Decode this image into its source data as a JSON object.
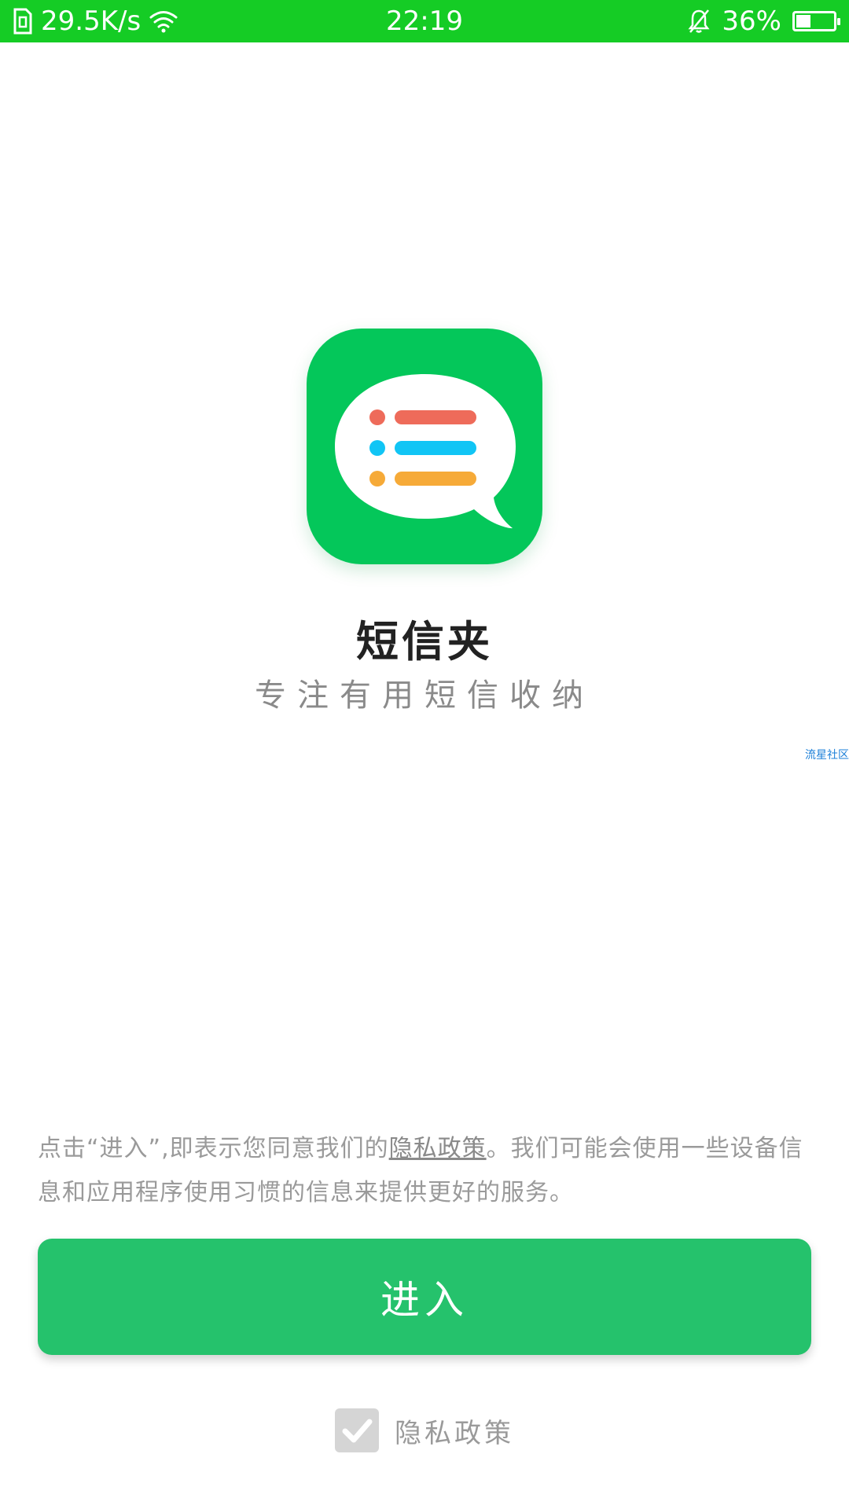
{
  "status_bar": {
    "network_speed": "29.5K/s",
    "time": "22:19",
    "battery_percent": "36%",
    "battery_level": 0.36,
    "background_color": "#15cc25"
  },
  "app": {
    "name": "短信夹",
    "tagline": "专注有用短信收纳",
    "icon_color": "#04c75a",
    "icon_line_colors": [
      "#ee6b5a",
      "#11c5f5",
      "#f6aa38"
    ]
  },
  "watermark": "流星社区",
  "notice": {
    "before_link": "点击“进入”,即表示您同意我们的",
    "link": "隐私政策",
    "after_link": "。我们可能会使用一些设备信息和应用程序使用习惯的信息来提供更好的服务。"
  },
  "enter_button": {
    "label": "进入",
    "color": "#25c26c"
  },
  "privacy_checkbox": {
    "label": "隐私政策",
    "checked": true
  }
}
